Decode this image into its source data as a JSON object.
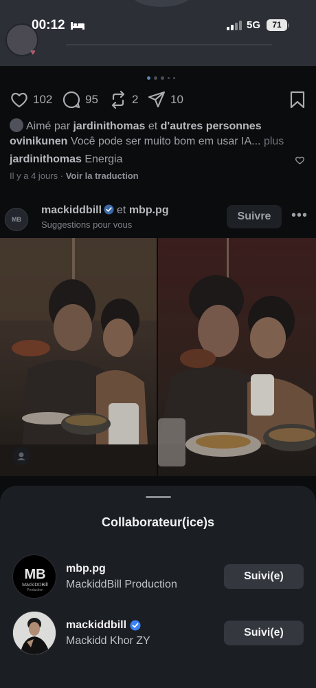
{
  "status_bar": {
    "time": "00:12",
    "network": "5G",
    "battery": "71"
  },
  "post": {
    "likes": "102",
    "comments": "95",
    "reposts": "2",
    "shares": "10",
    "liked_by_prefix": "Aimé par",
    "liked_by_user": "jardinithomas",
    "liked_by_and": "et",
    "liked_by_others": "d'autres personnes",
    "caption_user": "ovinikunen",
    "caption_text": "Você pode ser muito bom em usar IA...",
    "caption_more": "plus",
    "comment_user": "jardinithomas",
    "comment_text": "Energia",
    "time_ago": "Il y a 4 jours",
    "separator": "·",
    "translate": "Voir la traduction"
  },
  "next_post": {
    "user_1": "mackiddbill",
    "and": "et",
    "user_2": "mbp.pg",
    "suggestion": "Suggestions pour vous",
    "follow_label": "Suivre",
    "more_label": "•••",
    "avatar_text": "MB"
  },
  "sheet": {
    "title": "Collaborateur(ice)s",
    "collaborators": [
      {
        "username": "mbp.pg",
        "full_name": "MackiddBill Production",
        "verified": false,
        "button": "Suivi(e)",
        "logo_text": "MB",
        "logo_sub": "MackiDDBill",
        "logo_sub2": "Production"
      },
      {
        "username": "mackiddbill",
        "full_name": "Mackidd Khor ZY",
        "verified": true,
        "button": "Suivi(e)"
      }
    ]
  },
  "colors": {
    "verified": "#3b82f6",
    "sheet_bg": "#1b1e23",
    "button_bg": "#34373e"
  }
}
